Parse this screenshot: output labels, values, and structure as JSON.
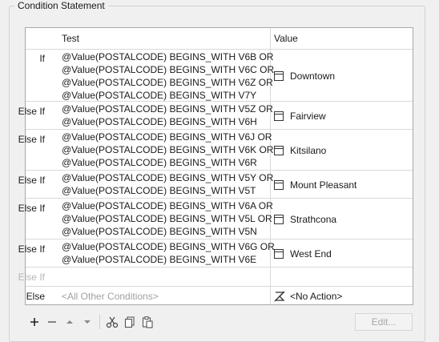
{
  "group": {
    "title": "Condition Statement"
  },
  "table": {
    "headers": {
      "test": "Test",
      "value": "Value"
    },
    "rows": [
      {
        "label": "If",
        "lines": [
          "@Value(POSTALCODE) BEGINS_WITH V6B OR",
          "@Value(POSTALCODE) BEGINS_WITH V6C OR",
          "@Value(POSTALCODE) BEGINS_WITH V6Z OR",
          "@Value(POSTALCODE) BEGINS_WITH V7Y"
        ],
        "value": "Downtown"
      },
      {
        "label": "Else If",
        "lines": [
          "@Value(POSTALCODE) BEGINS_WITH V5Z OR",
          "@Value(POSTALCODE) BEGINS_WITH V6H"
        ],
        "value": "Fairview"
      },
      {
        "label": "Else If",
        "lines": [
          "@Value(POSTALCODE) BEGINS_WITH V6J OR",
          "@Value(POSTALCODE) BEGINS_WITH V6K OR",
          "@Value(POSTALCODE) BEGINS_WITH V6R"
        ],
        "value": "Kitsilano"
      },
      {
        "label": "Else If",
        "lines": [
          "@Value(POSTALCODE) BEGINS_WITH V5Y OR",
          "@Value(POSTALCODE) BEGINS_WITH V5T"
        ],
        "value": "Mount Pleasant"
      },
      {
        "label": "Else If",
        "lines": [
          "@Value(POSTALCODE) BEGINS_WITH V6A OR",
          "@Value(POSTALCODE) BEGINS_WITH V5L OR",
          "@Value(POSTALCODE) BEGINS_WITH V5N"
        ],
        "value": "Strathcona"
      },
      {
        "label": "Else If",
        "lines": [
          "@Value(POSTALCODE) BEGINS_WITH V6G OR",
          "@Value(POSTALCODE) BEGINS_WITH V6E"
        ],
        "value": "West End"
      }
    ],
    "empty_row_label": "Else If",
    "else_row": {
      "label": "Else",
      "placeholder": "<All Other Conditions>",
      "value": "<No Action>"
    }
  },
  "toolbar": {
    "icons": [
      "plus-icon",
      "minus-icon",
      "move-up-icon",
      "move-down-icon",
      "cut-icon",
      "copy-icon",
      "paste-icon"
    ],
    "edit_label": "Edit..."
  }
}
